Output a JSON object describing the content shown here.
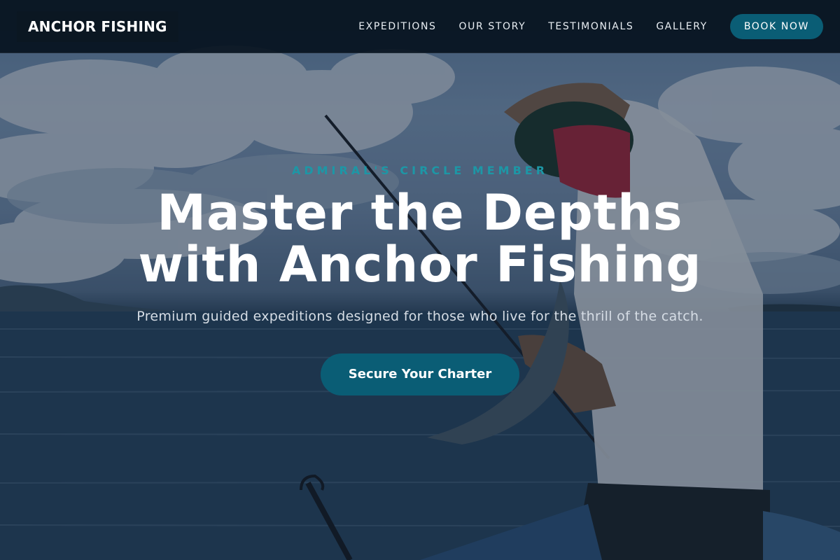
{
  "brand": {
    "name": "ANCHOR FISHING"
  },
  "nav": {
    "items": [
      {
        "label": "EXPEDITIONS"
      },
      {
        "label": "OUR STORY"
      },
      {
        "label": "TESTIMONIALS"
      },
      {
        "label": "GALLERY"
      }
    ],
    "book_label": "BOOK NOW"
  },
  "hero": {
    "eyebrow": "ADMIRAL'S CIRCLE MEMBER",
    "headline_line1": "Master the Depths",
    "headline_line2": "with Anchor Fishing",
    "subtext": "Premium guided expeditions designed for those who live for the thrill of the catch.",
    "cta_label": "Secure Your Charter"
  },
  "colors": {
    "accent": "#0a5d75",
    "eyebrow": "#1d97a6",
    "navbar_bg": "#06121e"
  }
}
